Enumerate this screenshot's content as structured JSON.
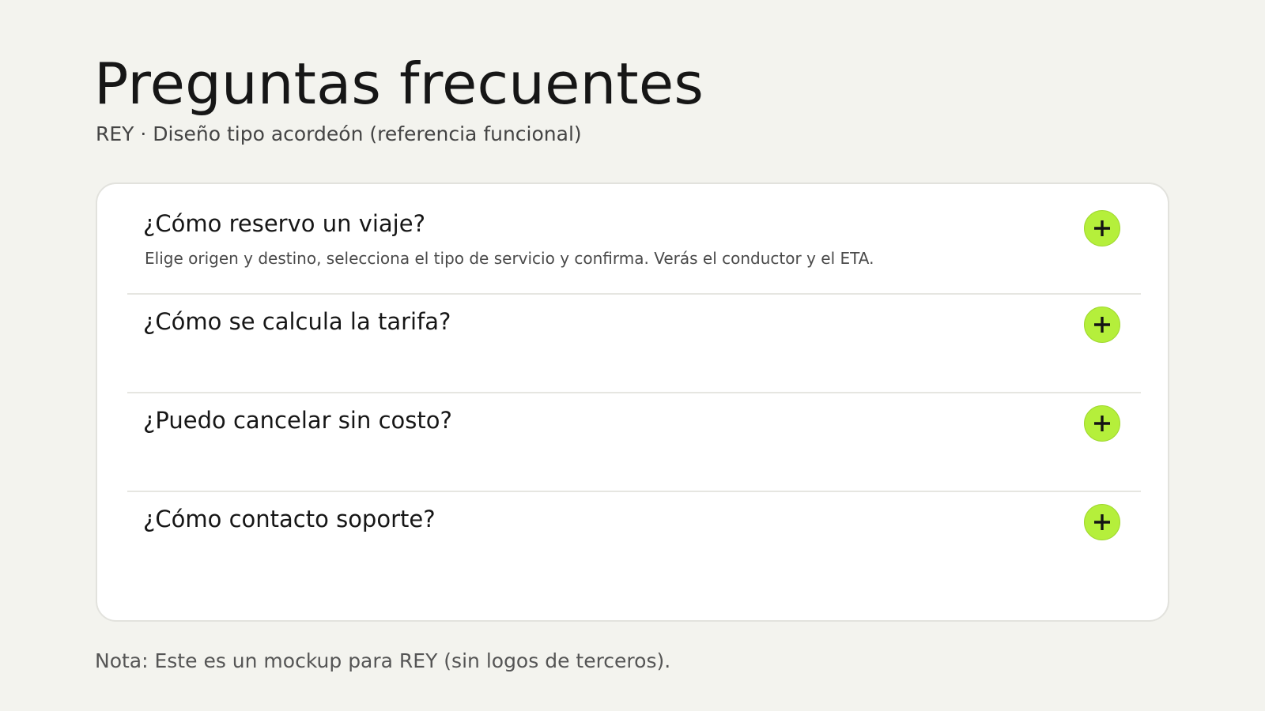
{
  "header": {
    "title": "Preguntas frecuentes",
    "subtitle": "REY · Diseño tipo acordeón (referencia funcional)"
  },
  "faq": {
    "items": [
      {
        "question": "¿Cómo reservo un viaje?",
        "answer": "Elige origen y destino, selecciona el tipo de servicio y confirma. Verás el conductor y el ETA.",
        "expanded": true,
        "toggle_icon": "plus-icon"
      },
      {
        "question": "¿Cómo se calcula la tarifa?",
        "answer": "",
        "expanded": false,
        "toggle_icon": "plus-icon"
      },
      {
        "question": "¿Puedo cancelar sin costo?",
        "answer": "",
        "expanded": false,
        "toggle_icon": "plus-icon"
      },
      {
        "question": "¿Cómo contacto soporte?",
        "answer": "",
        "expanded": false,
        "toggle_icon": "plus-icon"
      }
    ]
  },
  "footer": {
    "note": "Nota: Este es un mockup para REY (sin logos de terceros)."
  },
  "colors": {
    "background": "#f3f3ee",
    "card": "#ffffff",
    "accent": "#b5ef3b",
    "text": "#161616"
  }
}
